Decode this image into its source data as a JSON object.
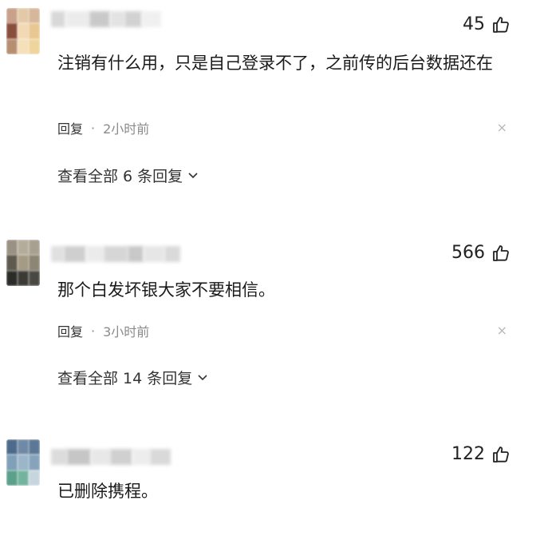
{
  "comments": [
    {
      "likes": "45",
      "text": "注销有什么用，只是自己登录不了，之前传的后台数据还在",
      "reply_label": "回复",
      "dot": "·",
      "time": "2小时前",
      "close": "×",
      "view_all": "查看全部 6 条回复"
    },
    {
      "likes": "566",
      "text": "那个白发坏银大家不要相信。",
      "reply_label": "回复",
      "dot": "·",
      "time": "3小时前",
      "close": "×",
      "view_all": "查看全部 14 条回复"
    },
    {
      "likes": "122",
      "text": "已删除携程。"
    }
  ],
  "icons": {
    "like": "thumbs-up-icon",
    "chevron": "chevron-down-icon",
    "close": "close-icon"
  }
}
